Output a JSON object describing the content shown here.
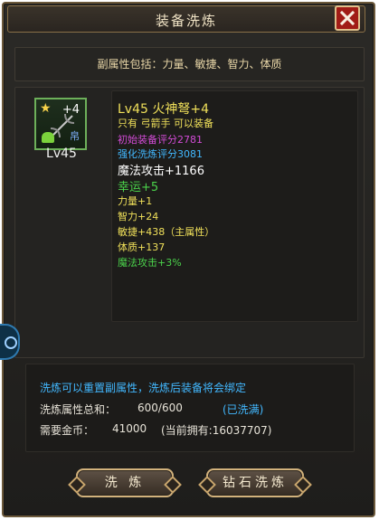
{
  "window": {
    "title": "装备洗炼",
    "close_icon": "close-icon"
  },
  "sub_attributes": "副属性包括：力量、敏捷、智力、体质",
  "item": {
    "plus": "+4",
    "level": "Lv45",
    "bind_mark": "帛",
    "icons": [
      "star-icon",
      "bow-icon",
      "heart-icon",
      "bind-icon"
    ]
  },
  "stats": {
    "name": "Lv45 火神弩+4",
    "restriction": "只有 弓箭手 可以装备",
    "initial_score": "初始装备评分2781",
    "refine_score": "强化洗炼评分3081",
    "magic_attack": "魔法攻击+1166",
    "luck": "幸运+5",
    "strength": "力量+1",
    "intelligence": "智力+24",
    "agility": "敏捷+438（主属性）",
    "constitution": "体质+137",
    "magic_attack_pct": "魔法攻击+3%"
  },
  "info": {
    "notice": "洗炼可以重置副属性，洗炼后装备将会绑定",
    "total_label": "洗炼属性总和：",
    "total_value": "600/600",
    "total_status": "(已洗满)",
    "gold_label": "需要金币：",
    "gold_value": "41000",
    "gold_owned": "(当前拥有:16037707)"
  },
  "buttons": {
    "refine": "洗 炼",
    "diamond_refine": "钻石洗炼"
  },
  "colors": {
    "title_gold": "#f1e4c6",
    "purple": "#d24bd6",
    "cyan": "#42b8ff",
    "green": "#4bd24b",
    "yellow": "#f0e05a",
    "white": "#ffffff"
  }
}
